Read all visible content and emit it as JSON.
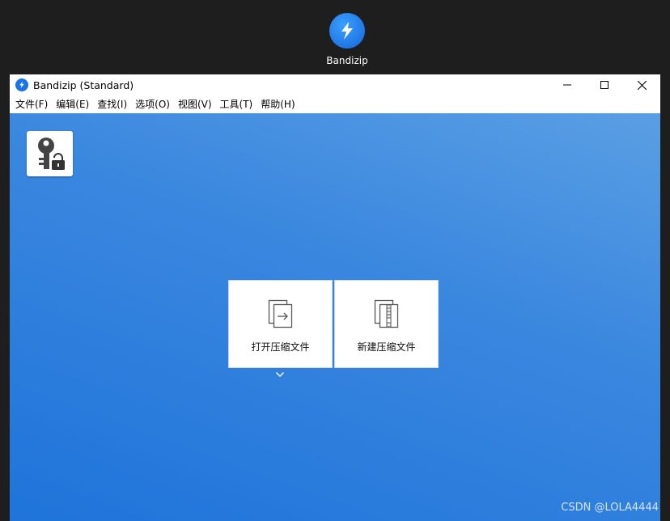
{
  "desktop": {
    "icon_label": "Bandizip"
  },
  "window": {
    "title": "Bandizip (Standard)"
  },
  "menu": [
    "文件(F)",
    "编辑(E)",
    "查找(I)",
    "选项(O)",
    "视图(V)",
    "工具(T)",
    "帮助(H)"
  ],
  "main": {
    "open_label": "打开压缩文件",
    "new_label": "新建压缩文件"
  },
  "watermark": "CSDN @LOLA4444",
  "colors": {
    "accent": "#1f74da",
    "gradient_top": "#5a9fe4"
  },
  "icons": [
    "bandizip-logo-icon",
    "key-lock-icon",
    "open-archive-icon",
    "new-archive-icon",
    "chevron-down-icon",
    "minimize-icon",
    "maximize-icon",
    "close-icon"
  ]
}
